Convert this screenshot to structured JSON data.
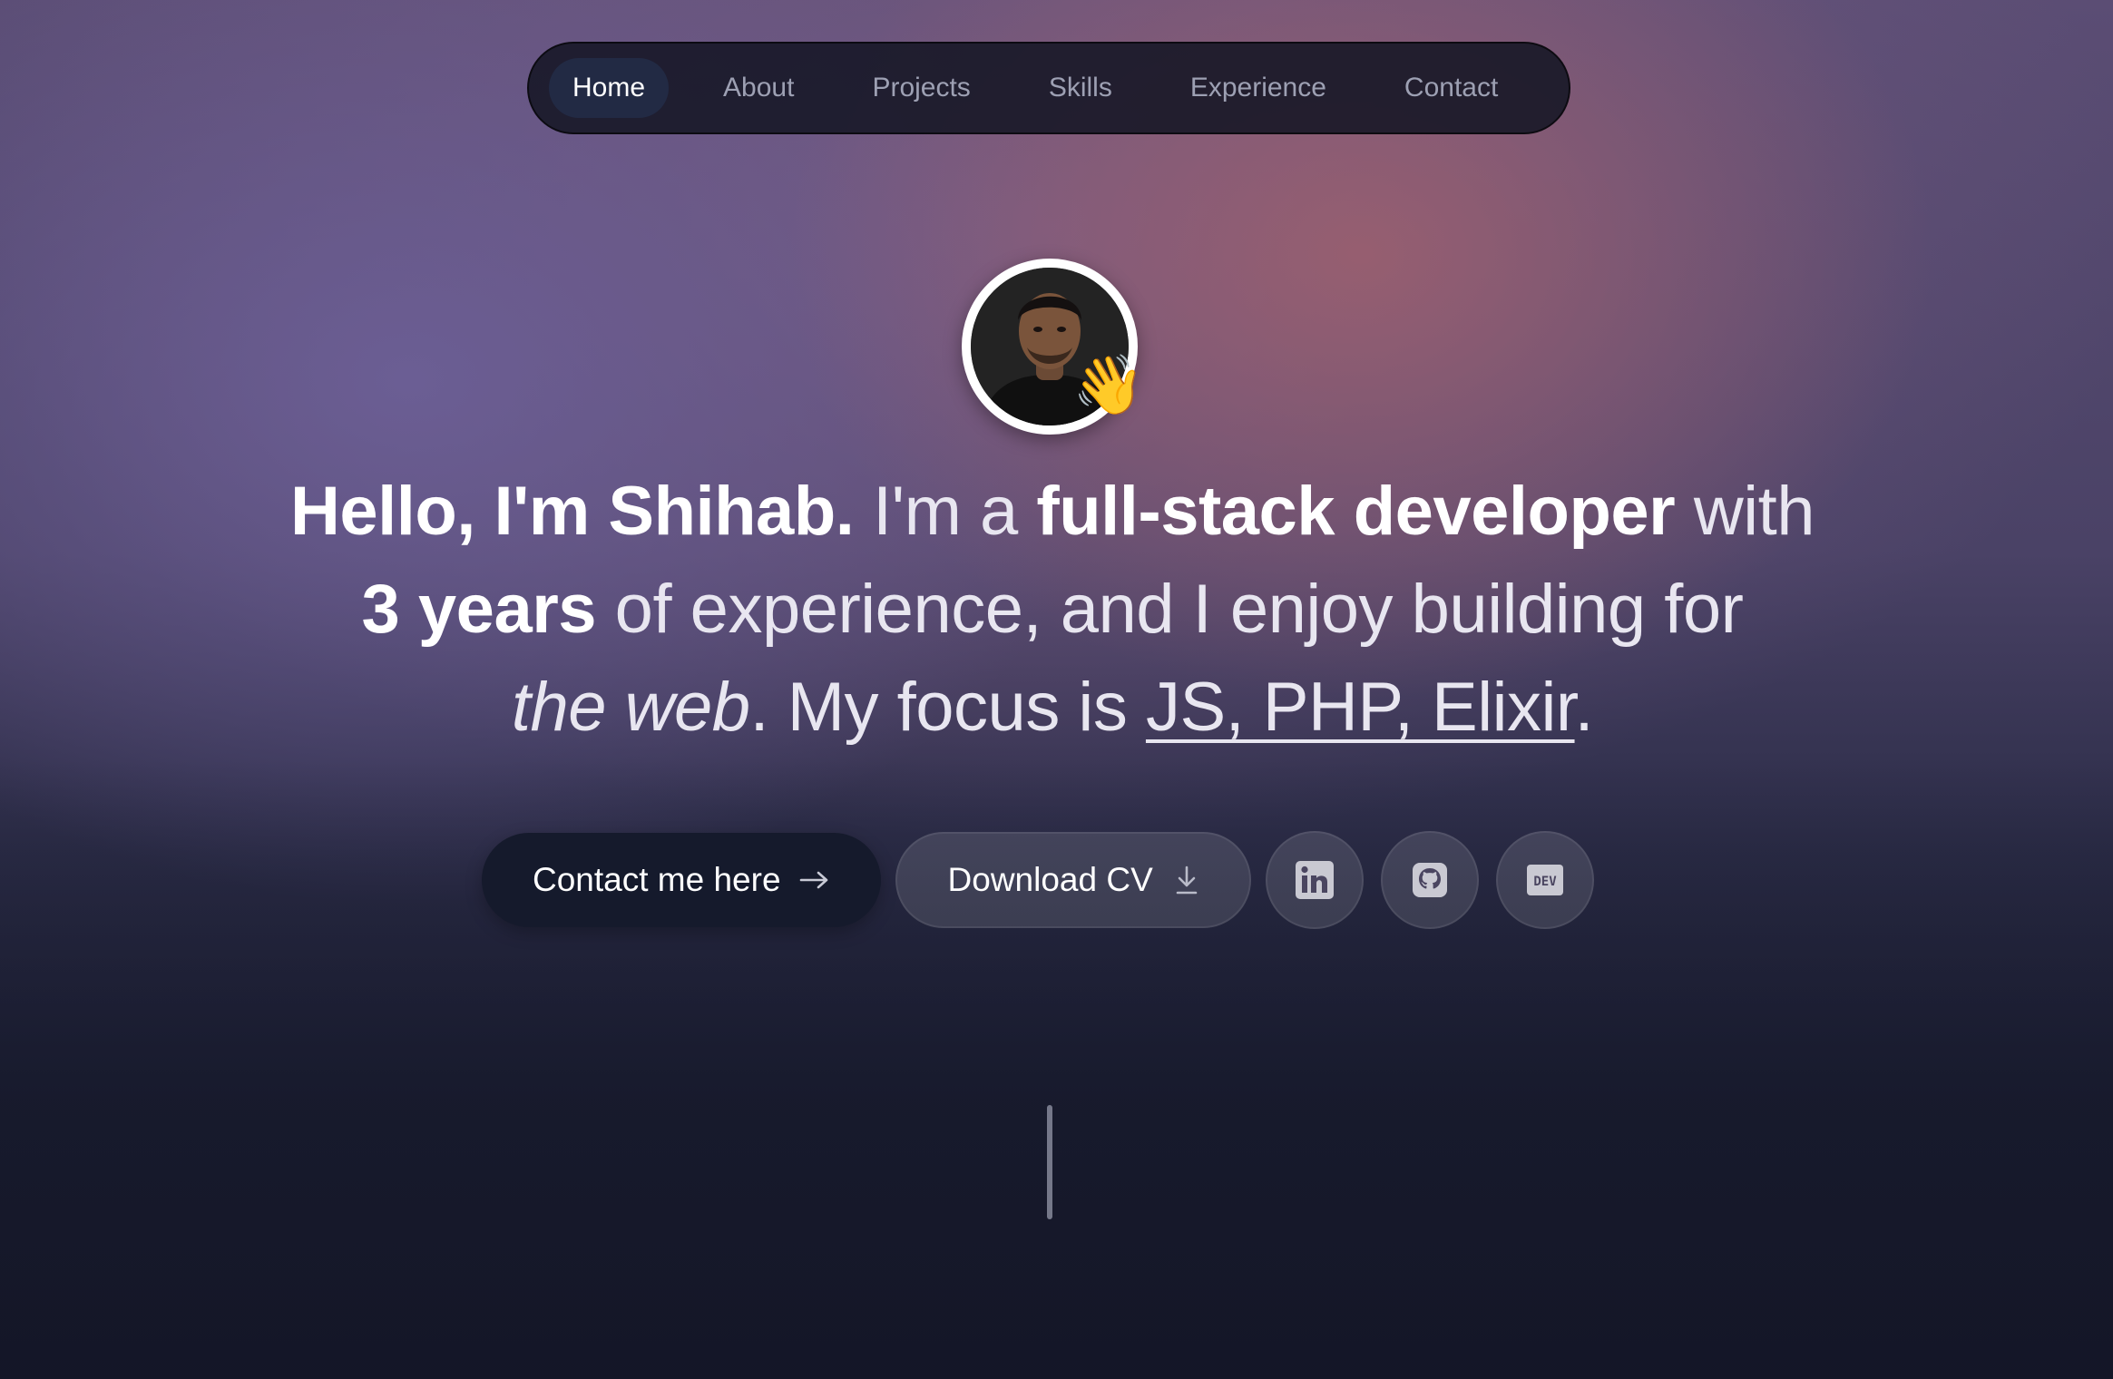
{
  "nav": {
    "items": [
      {
        "label": "Home",
        "active": true
      },
      {
        "label": "About",
        "active": false
      },
      {
        "label": "Projects",
        "active": false
      },
      {
        "label": "Skills",
        "active": false
      },
      {
        "label": "Experience",
        "active": false
      },
      {
        "label": "Contact",
        "active": false
      }
    ]
  },
  "hero": {
    "avatar_badge": "👋",
    "headline": {
      "greeting": "Hello, I'm Shihab.",
      "t1": " I'm a ",
      "role": "full-stack developer",
      "t2": " with ",
      "years": "3 years",
      "t3": " of experience, and I enjoy building for ",
      "web": "the web",
      "t4": ". My focus is ",
      "stack": "JS, PHP, Elixir",
      "t5": "."
    },
    "contact_button": "Contact me here",
    "cv_button": "Download CV",
    "social_icons": [
      "linkedin-icon",
      "github-icon",
      "dev-icon"
    ],
    "dev_icon_text": "DEV"
  },
  "colors": {
    "nav_bg": "#14162a",
    "nav_active_bg": "#222a44",
    "primary_button": "#151a2c",
    "text": "#ffffff"
  }
}
